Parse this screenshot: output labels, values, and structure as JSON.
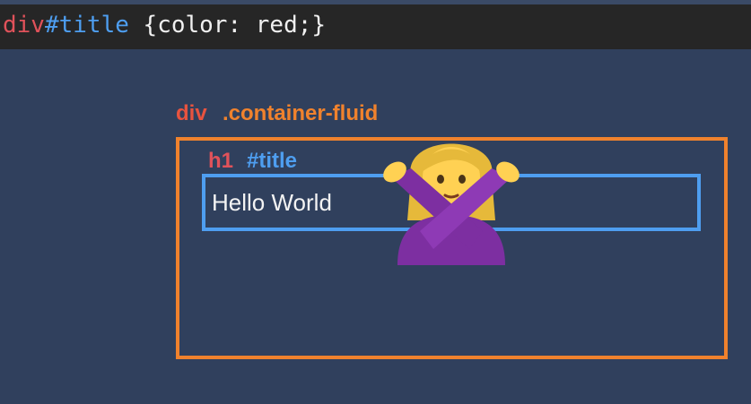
{
  "code": {
    "selector_tag": "div",
    "selector_id": "#title",
    "declaration": " {color: red;}"
  },
  "diagram": {
    "outer_tag": "div",
    "outer_class": ".container-fluid",
    "inner_tag": "h1",
    "inner_id": "#title",
    "inner_text": "Hello World"
  },
  "icons": {
    "emoji": "woman-gesturing-no-icon"
  },
  "colors": {
    "tag_red": "#e0525a",
    "id_blue": "#4e9ef0",
    "class_orange": "#f0822d",
    "background": "#30405d",
    "code_bar": "#262626"
  }
}
